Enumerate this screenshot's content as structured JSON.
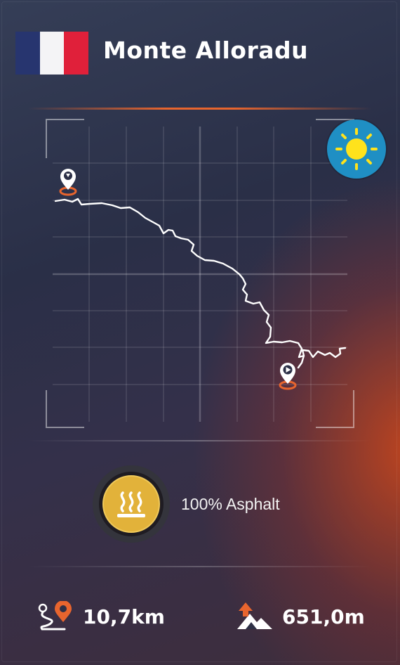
{
  "header": {
    "country_flag": "france-flag-icon",
    "flag_colors": [
      "#27356f",
      "#ffffff",
      "#e0203a"
    ],
    "title": "Monte Alloradu"
  },
  "map": {
    "start_marker": "start-pin-icon",
    "end_marker": "finish-pin-icon",
    "weather_icon": "sun-icon",
    "weather_color": "#1f8fc4"
  },
  "surface": {
    "icon": "asphalt-heat-icon",
    "label": "100% Asphalt"
  },
  "stats": {
    "distance_icon": "route-distance-icon",
    "distance": "10,7km",
    "elevation_icon": "elevation-gain-icon",
    "elevation": "651,0m"
  },
  "colors": {
    "accent": "#e8652e",
    "gold": "#e2b23a"
  }
}
